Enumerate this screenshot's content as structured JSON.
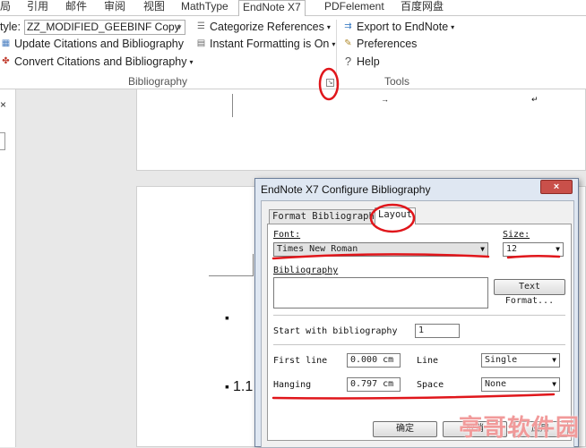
{
  "ribbon_tabs": [
    "局",
    "引用",
    "邮件",
    "审阅",
    "视图",
    "MathType",
    "EndNote X7",
    "PDFelement",
    "百度网盘"
  ],
  "active_tab": "EndNote X7",
  "bibliography_group": {
    "style_label": "tyle:",
    "style_value": "ZZ_MODIFIED_GEEBINF Copy",
    "update_label": "Update Citations and Bibliography",
    "convert_label": "Convert Citations and Bibliography",
    "categorize_label": "Categorize References",
    "instant_label": "Instant Formatting is On",
    "group_label": "Bibliography"
  },
  "tools_group": {
    "export_label": "Export to EndNote",
    "preferences_label": "Preferences",
    "help_label": "Help",
    "group_label": "Tools"
  },
  "document": {
    "left_close": "×",
    "bullet_a": "▪",
    "bullet_b": "▪",
    "heading_fragment": "1.1"
  },
  "dialog": {
    "title": "EndNote X7 Configure Bibliography",
    "close_label": "×",
    "tab_format": "Format Bibliography",
    "tab_layout": "Layout",
    "font_label": "Font:",
    "font_value": "Times New Roman",
    "size_label": "Size:",
    "size_value": "12",
    "bibliography_label": "Bibliography",
    "text_format_button": "Text Format...",
    "start_with_label": "Start with bibliography",
    "start_with_value": "1",
    "first_line_label": "First line",
    "first_line_value": "0.000 cm",
    "line_label": "Line",
    "line_value": "Single",
    "hanging_label": "Hanging",
    "hanging_value": "0.797 cm",
    "space_label": "Space",
    "space_value": "None",
    "ok_button": "确定",
    "cancel_button": "取消",
    "apply_button": "应用"
  },
  "watermark": "亭哥软件园",
  "colors": {
    "annotation_red": "#e0161b",
    "dialog_frame": "#dfe7f2",
    "close_button": "#c9504a"
  }
}
